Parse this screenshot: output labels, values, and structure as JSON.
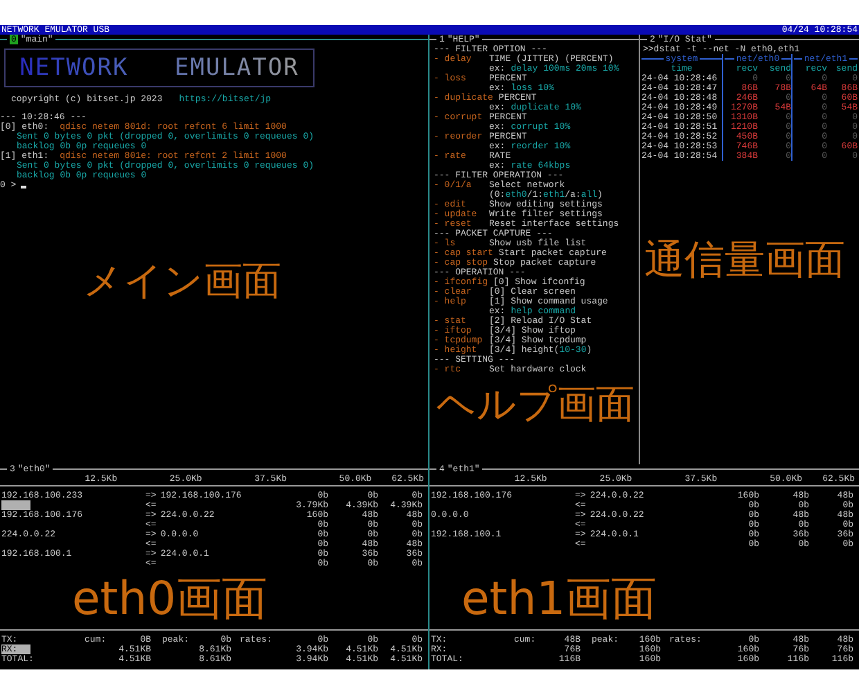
{
  "title_bar": {
    "title": "NETWORK EMULATOR USB",
    "clock": "04/24 10:28:54"
  },
  "main_pane": {
    "index": "0",
    "name": "\"main\"",
    "selected": true,
    "logo": "NETWORK EMULATOR",
    "copyright": "copyright (c) bitset.jp 2023",
    "link": "https://bitset/jp",
    "caption": "メイン画面",
    "lines": [
      {
        "kind": "time",
        "text": "--- 10:28:46 ---"
      },
      {
        "kind": "qdisc",
        "label": "[0] eth0:",
        "text": "qdisc netem 801d: root refcnt 6 limit 1000"
      },
      {
        "kind": "stats",
        "text": "Sent 0 bytes 0 pkt (dropped 0, overlimits 0 requeues 0)"
      },
      {
        "kind": "stats",
        "text": "backlog 0b 0p requeues 0"
      },
      {
        "kind": "qdisc",
        "label": "[1] eth1:",
        "text": "qdisc netem 801e: root refcnt 2 limit 1000"
      },
      {
        "kind": "stats",
        "text": "Sent 0 bytes 0 pkt (dropped 0, overlimits 0 requeues 0)"
      },
      {
        "kind": "stats",
        "text": "backlog 0b 0p requeues 0"
      },
      {
        "kind": "prompt",
        "text": "0 >"
      }
    ]
  },
  "help_pane": {
    "index": "1",
    "name": "\"HELP\"",
    "selected": false,
    "caption": "ヘルプ画面",
    "items": [
      {
        "kind": "heading",
        "text": "--- FILTER OPTION ---"
      },
      {
        "kind": "command",
        "key": "- delay",
        "desc": "TIME (JITTER) (PERCENT)"
      },
      {
        "kind": "note",
        "prefix": "ex:",
        "parts": [
          {
            "text": "delay 100ms 20ms 10%",
            "highlight": true
          }
        ]
      },
      {
        "kind": "command",
        "key": "- loss",
        "desc": "PERCENT"
      },
      {
        "kind": "note",
        "prefix": "ex:",
        "parts": [
          {
            "text": "loss 10%",
            "highlight": true
          }
        ]
      },
      {
        "kind": "command",
        "key": "- duplicate",
        "desc": "PERCENT"
      },
      {
        "kind": "note",
        "prefix": "ex:",
        "parts": [
          {
            "text": "duplicate 10%",
            "highlight": true
          }
        ]
      },
      {
        "kind": "command",
        "key": "- corrupt",
        "desc": "PERCENT"
      },
      {
        "kind": "note",
        "prefix": "ex:",
        "parts": [
          {
            "text": "corrupt 10%",
            "highlight": true
          }
        ]
      },
      {
        "kind": "command",
        "key": "- reorder",
        "desc": "PERCENT"
      },
      {
        "kind": "note",
        "prefix": "ex:",
        "parts": [
          {
            "text": "reorder 10%",
            "highlight": true
          }
        ]
      },
      {
        "kind": "command",
        "key": "- rate",
        "desc": "RATE"
      },
      {
        "kind": "note",
        "prefix": "ex:",
        "parts": [
          {
            "text": "rate 64kbps",
            "highlight": true
          }
        ]
      },
      {
        "kind": "heading",
        "text": "--- FILTER OPERATION ---"
      },
      {
        "kind": "command",
        "key": "- 0/1/a",
        "desc": "Select network"
      },
      {
        "kind": "note",
        "parts": [
          {
            "text": "(0:",
            "highlight": false
          },
          {
            "text": "eth0",
            "highlight": true
          },
          {
            "text": "/1:",
            "highlight": false
          },
          {
            "text": "eth1",
            "highlight": true
          },
          {
            "text": "/a:",
            "highlight": false
          },
          {
            "text": "all",
            "highlight": true
          },
          {
            "text": ")",
            "highlight": false
          }
        ]
      },
      {
        "kind": "command",
        "key": "- edit",
        "desc": "Show editing settings"
      },
      {
        "kind": "command",
        "key": "- update",
        "desc": "Write filter settings"
      },
      {
        "kind": "command",
        "key": "- reset",
        "desc": "Reset interface settings"
      },
      {
        "kind": "heading",
        "text": "--- PACKET CAPTURE ---"
      },
      {
        "kind": "command",
        "key": "- ls",
        "desc": "Show usb file list"
      },
      {
        "kind": "command",
        "key": "- cap start",
        "desc": "Start packet capture"
      },
      {
        "kind": "command",
        "key": "- cap stop",
        "desc": "Stop packet capture"
      },
      {
        "kind": "heading",
        "text": "--- OPERATION ---"
      },
      {
        "kind": "command",
        "key": "- ifconfig",
        "desc": "[0] Show ifconfig"
      },
      {
        "kind": "command",
        "key": "- clear",
        "desc": "[0] Clear screen"
      },
      {
        "kind": "command",
        "key": "- help",
        "desc": "[1] Show command usage"
      },
      {
        "kind": "note",
        "prefix": "ex:",
        "parts": [
          {
            "text": "help command",
            "highlight": true
          }
        ]
      },
      {
        "kind": "command",
        "key": "- stat",
        "desc": "[2] Reload I/O Stat"
      },
      {
        "kind": "command",
        "key": "- iftop",
        "desc": "[3/4] Show iftop"
      },
      {
        "kind": "command",
        "key": "- tcpdump",
        "desc": "[3/4] Show tcpdump"
      },
      {
        "kind": "command",
        "key": "- height",
        "parts": [
          {
            "text": "[3/4] height(",
            "highlight": false
          },
          {
            "text": "10-30",
            "highlight": true
          },
          {
            "text": ")",
            "highlight": false
          }
        ]
      },
      {
        "kind": "heading",
        "text": "--- SETTING ---"
      },
      {
        "kind": "command",
        "key": "- rtc",
        "desc": "Set hardware clock"
      }
    ]
  },
  "stat_pane": {
    "index": "2",
    "name": "\"I/O Stat\"",
    "selected": false,
    "caption": "通信量画面",
    "command": ">>dstat -t --net -N eth0,eth1",
    "groups": [
      "system",
      "net/eth0",
      "net/eth1"
    ],
    "columns": [
      "time",
      "recv",
      "send",
      "recv",
      "send"
    ],
    "rows": [
      {
        "cells": [
          {
            "text": "24-04 10:28:46"
          },
          {
            "text": "0",
            "hot": false
          },
          {
            "text": "0",
            "hot": false
          },
          {
            "text": "0",
            "hot": false
          },
          {
            "text": "0",
            "hot": false
          }
        ]
      },
      {
        "cells": [
          {
            "text": "24-04 10:28:47"
          },
          {
            "text": "86B",
            "hot": true
          },
          {
            "text": "78B",
            "hot": true
          },
          {
            "text": "64B",
            "hot": true
          },
          {
            "text": "86B",
            "hot": true
          }
        ]
      },
      {
        "cells": [
          {
            "text": "24-04 10:28:48"
          },
          {
            "text": "246B",
            "hot": true
          },
          {
            "text": "0",
            "hot": false
          },
          {
            "text": "0",
            "hot": false
          },
          {
            "text": "60B",
            "hot": true
          }
        ]
      },
      {
        "cells": [
          {
            "text": "24-04 10:28:49"
          },
          {
            "text": "1270B",
            "hot": true
          },
          {
            "text": "54B",
            "hot": true
          },
          {
            "text": "0",
            "hot": false
          },
          {
            "text": "54B",
            "hot": true
          }
        ]
      },
      {
        "cells": [
          {
            "text": "24-04 10:28:50"
          },
          {
            "text": "1310B",
            "hot": true
          },
          {
            "text": "0",
            "hot": false
          },
          {
            "text": "0",
            "hot": false
          },
          {
            "text": "0",
            "hot": false
          }
        ]
      },
      {
        "cells": [
          {
            "text": "24-04 10:28:51"
          },
          {
            "text": "1210B",
            "hot": true
          },
          {
            "text": "0",
            "hot": false
          },
          {
            "text": "0",
            "hot": false
          },
          {
            "text": "0",
            "hot": false
          }
        ]
      },
      {
        "cells": [
          {
            "text": "24-04 10:28:52"
          },
          {
            "text": "450B",
            "hot": true
          },
          {
            "text": "0",
            "hot": false
          },
          {
            "text": "0",
            "hot": false
          },
          {
            "text": "0",
            "hot": false
          }
        ]
      },
      {
        "cells": [
          {
            "text": "24-04 10:28:53"
          },
          {
            "text": "746B",
            "hot": true
          },
          {
            "text": "0",
            "hot": false
          },
          {
            "text": "0",
            "hot": false
          },
          {
            "text": "60B",
            "hot": true
          }
        ]
      },
      {
        "cells": [
          {
            "text": "24-04 10:28:54"
          },
          {
            "text": "384B",
            "hot": true
          },
          {
            "text": "0",
            "hot": false
          },
          {
            "text": "0",
            "hot": false
          },
          {
            "text": "0",
            "hot": false
          }
        ]
      }
    ]
  },
  "eth0_pane": {
    "index": "3",
    "name": "\"eth0\"",
    "selected": false,
    "caption": "eth0画面",
    "scale": [
      "12.5Kb",
      "25.0Kb",
      "37.5Kb",
      "50.0Kb",
      "62.5Kb"
    ],
    "flows": [
      {
        "host": "192.168.100.233",
        "send_mark": "=>",
        "peer": "192.168.100.176",
        "out": [
          "0b",
          "0b",
          "0b"
        ],
        "recv_mark": "<=",
        "in": [
          "3.79Kb",
          "4.39Kb",
          "4.39Kb"
        ],
        "level": 0.07
      },
      {
        "host": "192.168.100.176",
        "send_mark": "=>",
        "peer": "224.0.0.22",
        "out": [
          "160b",
          "48b",
          "48b"
        ],
        "recv_mark": "<=",
        "in": [
          "0b",
          "0b",
          "0b"
        ]
      },
      {
        "host": "224.0.0.22",
        "send_mark": "=>",
        "peer": "0.0.0.0",
        "out": [
          "0b",
          "0b",
          "0b"
        ],
        "recv_mark": "<=",
        "in": [
          "0b",
          "48b",
          "48b"
        ]
      },
      {
        "host": "192.168.100.1",
        "send_mark": "=>",
        "peer": "224.0.0.1",
        "out": [
          "0b",
          "36b",
          "36b"
        ],
        "recv_mark": "<=",
        "in": [
          "0b",
          "0b",
          "0b"
        ]
      }
    ],
    "totals": [
      {
        "label": "TX:",
        "cum_label": "cum:",
        "cum": "0B",
        "peak_label": "peak:",
        "peak": "0b",
        "rates_label": "rates:",
        "rates": [
          "0b",
          "0b",
          "0b"
        ]
      },
      {
        "label": "RX:",
        "cum": "4.51KB",
        "peak": "8.61Kb",
        "rates": [
          "3.94Kb",
          "4.51Kb",
          "4.51Kb"
        ],
        "level": 0.07
      },
      {
        "label": "TOTAL:",
        "cum": "4.51KB",
        "peak": "8.61Kb",
        "rates": [
          "3.94Kb",
          "4.51Kb",
          "4.51Kb"
        ]
      }
    ]
  },
  "eth1_pane": {
    "index": "4",
    "name": "\"eth1\"",
    "selected": false,
    "caption": "eth1画面",
    "scale": [
      "12.5Kb",
      "25.0Kb",
      "37.5Kb",
      "50.0Kb",
      "62.5Kb"
    ],
    "flows": [
      {
        "host": "192.168.100.176",
        "send_mark": "=>",
        "peer": "224.0.0.22",
        "out": [
          "160b",
          "48b",
          "48b"
        ],
        "recv_mark": "<=",
        "in": [
          "0b",
          "0b",
          "0b"
        ]
      },
      {
        "host": "0.0.0.0",
        "send_mark": "=>",
        "peer": "224.0.0.22",
        "out": [
          "0b",
          "48b",
          "48b"
        ],
        "recv_mark": "<=",
        "in": [
          "0b",
          "0b",
          "0b"
        ]
      },
      {
        "host": "192.168.100.1",
        "send_mark": "=>",
        "peer": "224.0.0.1",
        "out": [
          "0b",
          "36b",
          "36b"
        ],
        "recv_mark": "<=",
        "in": [
          "0b",
          "0b",
          "0b"
        ]
      }
    ],
    "totals": [
      {
        "label": "TX:",
        "cum_label": "cum:",
        "cum": "48B",
        "peak_label": "peak:",
        "peak": "160b",
        "rates_label": "rates:",
        "rates": [
          "0b",
          "48b",
          "48b"
        ]
      },
      {
        "label": "RX:",
        "cum": "76B",
        "peak": "160b",
        "rates": [
          "160b",
          "76b",
          "76b"
        ]
      },
      {
        "label": "TOTAL:",
        "cum": "116B",
        "peak": "160b",
        "rates": [
          "160b",
          "116b",
          "116b"
        ]
      }
    ]
  }
}
